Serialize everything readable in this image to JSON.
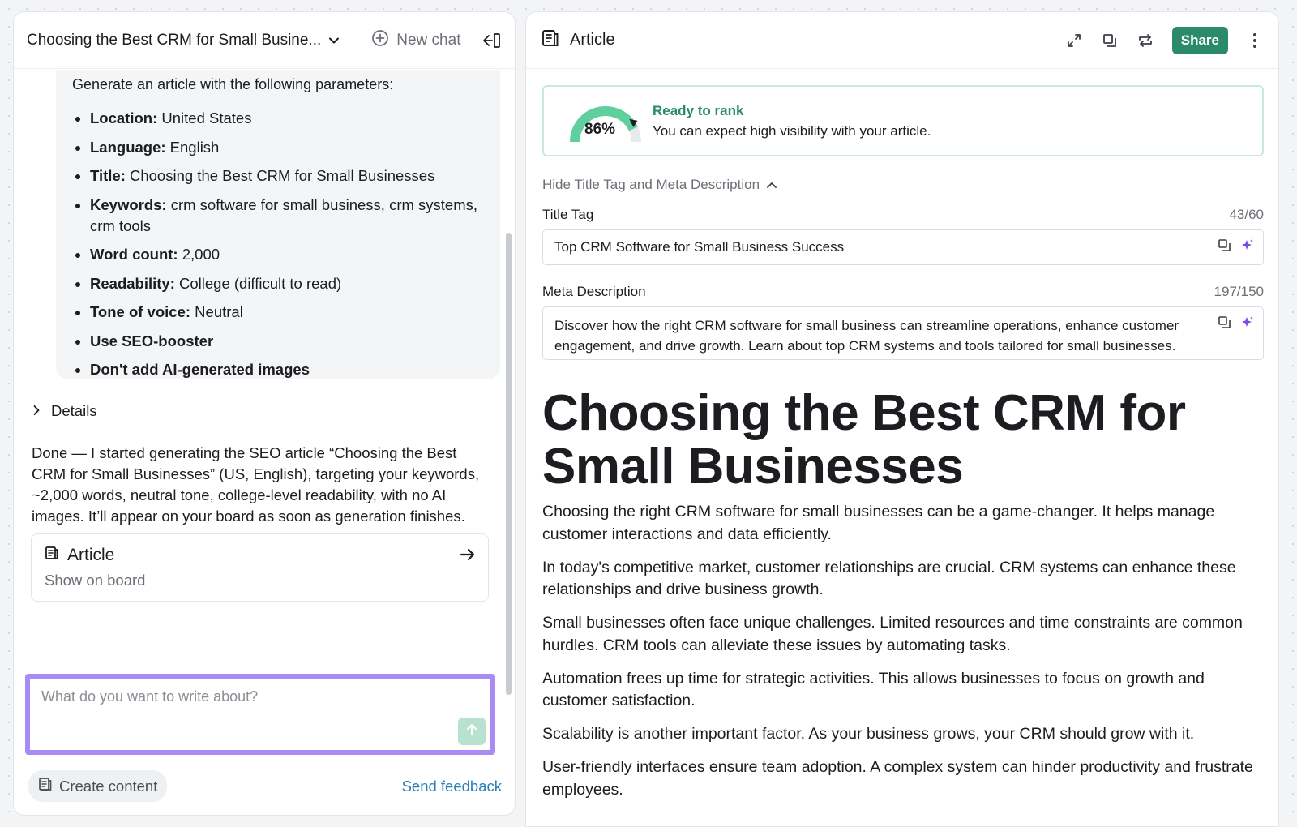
{
  "left": {
    "chat_title": "Choosing the Best CRM for Small Busine...",
    "new_chat_label": "New chat",
    "prompt_intro": "Generate an article with the following parameters:",
    "params": [
      {
        "label": "Location:",
        "value": " United States"
      },
      {
        "label": "Language:",
        "value": " English"
      },
      {
        "label": "Title:",
        "value": " Choosing the Best CRM for Small Businesses"
      },
      {
        "label": "Keywords:",
        "value": " crm software for small business, crm systems, crm tools"
      },
      {
        "label": "Word count:",
        "value": " 2,000"
      },
      {
        "label": "Readability:",
        "value": " College (difficult to read)"
      },
      {
        "label": "Tone of voice:",
        "value": " Neutral"
      },
      {
        "label": "Use SEO-booster",
        "value": ""
      },
      {
        "label": "Don't add AI-generated images",
        "value": ""
      }
    ],
    "details_label": "Details",
    "done_text": "Done — I started generating the SEO article “Choosing the Best CRM for Small Businesses” (US, English), targeting your keywords, ~2,000 words, neutral tone, college-level readability, with no AI images. It’ll appear on your board as soon as generation finishes.",
    "card": {
      "title": "Article",
      "subtitle": "Show on board"
    },
    "input_placeholder": "What do you want to write about?",
    "create_content_label": "Create content",
    "send_feedback_label": "Send feedback"
  },
  "right": {
    "title": "Article",
    "share_label": "Share",
    "rank": {
      "percent": 86,
      "percent_label": "86%",
      "status": "Ready to rank",
      "message": "You can expect high visibility with your article."
    },
    "hide_toggle_label": "Hide Title Tag and Meta Description",
    "title_tag": {
      "label": "Title Tag",
      "count": "43/60",
      "value": "Top CRM Software for Small Business Success"
    },
    "meta": {
      "label": "Meta Description",
      "count": "197/150",
      "value": "Discover how the right CRM software for small business can streamline operations, enhance customer engagement, and drive growth. Learn about top CRM systems and tools tailored for small businesses."
    },
    "heading": "Choosing the Best CRM for Small Businesses",
    "paragraphs": [
      "Choosing the right CRM software for small businesses can be a game-changer. It helps manage customer interactions and data efficiently.",
      "In today's competitive market, customer relationships are crucial. CRM systems can enhance these relationships and drive business growth.",
      "Small businesses often face unique challenges. Limited resources and time constraints are common hurdles. CRM tools can alleviate these issues by automating tasks.",
      "Automation frees up time for strategic activities. This allows businesses to focus on growth and customer satisfaction.",
      "Scalability is another important factor. As your business grows, your CRM should grow with it.",
      "User-friendly interfaces ensure team adoption. A complex system can hinder productivity and frustrate employees."
    ]
  },
  "colors": {
    "accent_green": "#2b8a6c",
    "input_border": "#a98bf5",
    "link_blue": "#2c7fb8"
  }
}
